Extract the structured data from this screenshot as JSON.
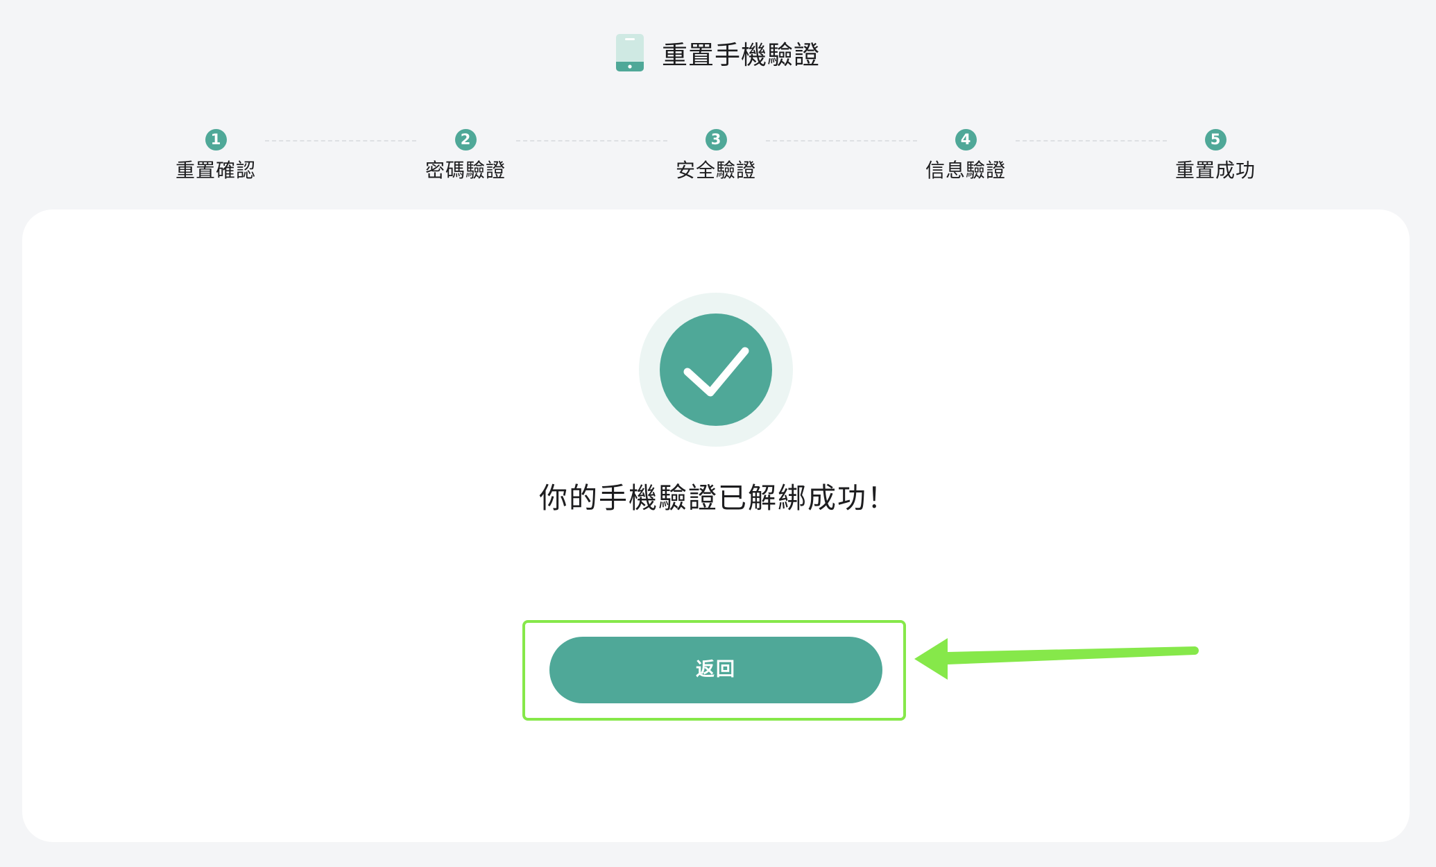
{
  "header": {
    "title": "重置手機驗證",
    "icon": "phone-icon"
  },
  "steps": [
    {
      "num": "1",
      "label": "重置確認"
    },
    {
      "num": "2",
      "label": "密碼驗證"
    },
    {
      "num": "3",
      "label": "安全驗證"
    },
    {
      "num": "4",
      "label": "信息驗證"
    },
    {
      "num": "5",
      "label": "重置成功"
    }
  ],
  "result": {
    "icon": "check-circle-icon",
    "message": "你的手機驗證已解綁成功！"
  },
  "actions": {
    "back_label": "返回"
  },
  "colors": {
    "accent": "#4fa898",
    "accent_light": "#ecf5f3",
    "highlight": "#86e84a",
    "background": "#f4f5f7",
    "card": "#ffffff"
  }
}
